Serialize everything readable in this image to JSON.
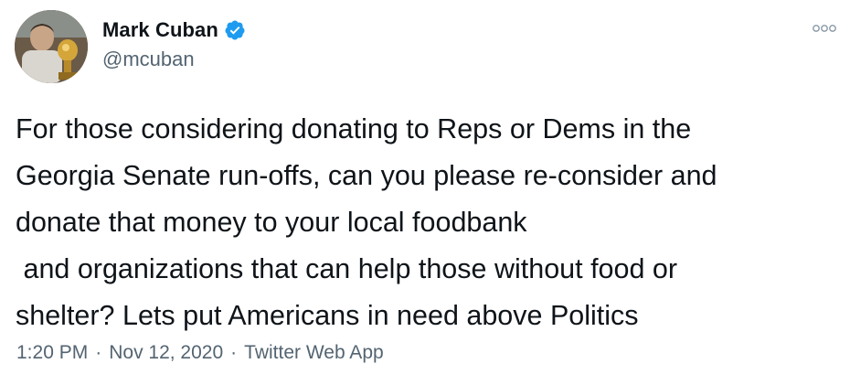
{
  "author": {
    "display_name": "Mark Cuban",
    "handle": "@mcuban",
    "verified": true
  },
  "icons": {
    "verified": "verified-badge-icon",
    "more": "more-options-icon"
  },
  "tweet": {
    "text": "For those considering donating to Reps or Dems in the\nGeorgia Senate run-offs, can you please re-consider and\ndonate that money to your local foodbank\n and organizations that can help those without food or\nshelter? Lets put Americans in need above Politics"
  },
  "meta": {
    "time": "1:20 PM",
    "separator": "·",
    "date": "Nov 12, 2020",
    "source": "Twitter Web App"
  },
  "colors": {
    "verified_blue": "#1d9bf0",
    "secondary_text": "#536471",
    "primary_text": "#0f1419"
  }
}
